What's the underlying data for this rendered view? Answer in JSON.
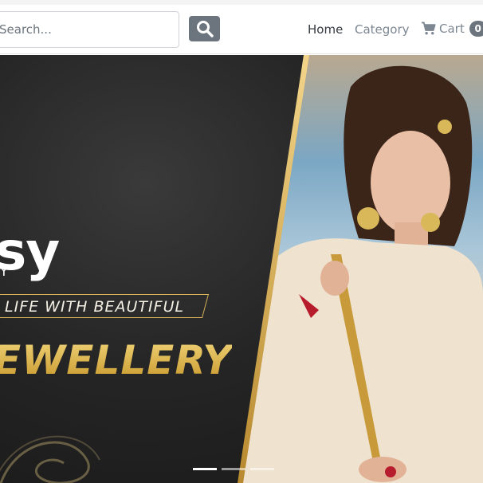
{
  "header": {
    "search": {
      "placeholder": "Search...",
      "value": ""
    },
    "search_button_icon": "search-icon",
    "nav": {
      "home_label": "Home",
      "category_label": "Category",
      "cart_label": "Cart",
      "cart_icon": "cart-icon",
      "cart_count": "0"
    }
  },
  "banner": {
    "brand_fragment": "sy",
    "brand_sub_fragment": "Y",
    "tagline": "LIFE WITH BEAUTIFUL",
    "headline": "EWELLERY",
    "slides": [
      {
        "active": true
      },
      {
        "active": false
      },
      {
        "active": false
      }
    ]
  },
  "colors": {
    "nav_active": "#343a40",
    "nav_muted": "#7d8791",
    "button_gray": "#6c757d",
    "gold": "#d6ac3c"
  }
}
